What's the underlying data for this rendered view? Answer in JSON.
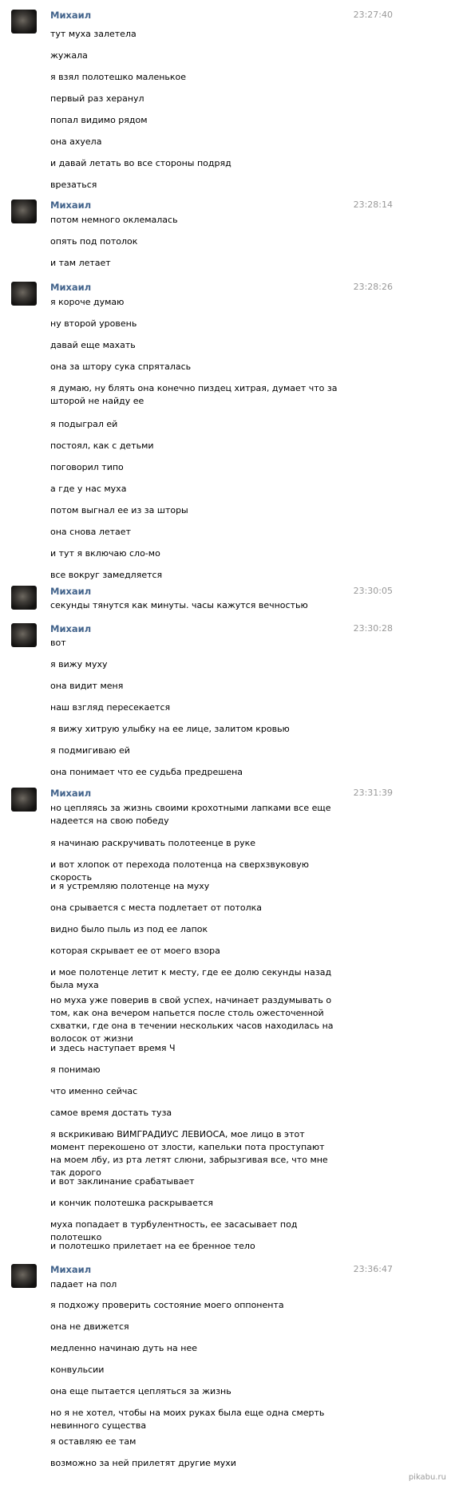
{
  "messages": [
    {
      "author": "Михаил",
      "time": "23:27:40",
      "lines": [
        "тут муха залетела",
        "жужала",
        "я взял полотешко маленькое",
        "первый раз херанул",
        "попал видимо рядом",
        "она ахуела",
        "и давай летать во все стороны подряд",
        "врезаться"
      ]
    },
    {
      "author": "Михаил",
      "time": "23:28:14",
      "lines": [
        "потом немного оклемалась",
        "опять под потолок",
        "и там летает"
      ]
    },
    {
      "author": "Михаил",
      "time": "23:28:26",
      "lines": [
        "я короче думаю",
        "ну второй уровень",
        "давай еще махать",
        "она за штору сука спряталась",
        "я думаю, ну блять она конечно пиздец хитрая, думает что за шторой не найду ее",
        "я подыграл ей",
        "постоял, как с детьми",
        "поговорил типо",
        "а где у нас муха",
        "потом выгнал ее из за шторы",
        "она снова летает",
        "и тут я включаю сло-мо",
        "все вокруг замедляется"
      ]
    },
    {
      "author": "Михаил",
      "time": "23:30:05",
      "lines": [
        "секунды тянутся как минуты. часы кажутся вечностью"
      ]
    },
    {
      "author": "Михаил",
      "time": "23:30:28",
      "lines": [
        "вот",
        "я вижу муху",
        "она видит меня",
        "наш взгляд пересекается",
        "я вижу хитрую улыбку на ее лице, залитом кровью",
        "я подмигиваю ей",
        "она понимает что ее судьба предрешена"
      ]
    },
    {
      "author": "Михаил",
      "time": "23:31:39",
      "lines": [
        "но цепляясь за жизнь своими крохотными лапками все еще надеется на свою победу",
        "я начинаю раскручивать полотеенце в руке",
        "и вот хлопок от перехода полотенца на сверхзвуковую скорость",
        "и я устремляю полотенце на муху",
        "она срывается с места подлетает от потолка",
        "видно было пыль из под ее лапок",
        "которая скрывает ее от моего взора",
        "и мое полотенце летит к месту, где ее долю секунды назад была муха",
        "но муха уже поверив в свой успех, начинает раздумывать о том, как она вечером напьется после столь ожесточенной схватки, где она в течении нескольких часов находилась на волосок от жизни",
        "и здесь наступает время Ч",
        "я понимаю",
        "что именно сейчас",
        "самое время достать туза",
        "я вскрикиваю ВИМГРАДИУС ЛЕВИОСА, мое лицо в этот момент перекошено от злости, капельки пота проступают на моем лбу, из рта летят слюни, забрызгивая все, что мне так дорого",
        "и вот заклинание срабатывает",
        "и кончик полотешка раскрывается",
        "муха попадает в турбулентность, ее засасывает под полотешко",
        "и полотешко прилетает на ее бренное тело"
      ]
    },
    {
      "author": "Михаил",
      "time": "23:36:47",
      "lines": [
        "падает на пол",
        "я подхожу проверить состояние моего оппонента",
        "она не движется",
        "медленно начинаю дуть на нее",
        "конвульсии",
        "она еще пытается цепляться за жизнь",
        "но я не хотел, чтобы на моих руках была еще одна смерть невинного существа",
        "я оставляю ее там",
        "возможно за ней прилетят другие мухи"
      ]
    }
  ],
  "watermark": "pikabu.ru"
}
